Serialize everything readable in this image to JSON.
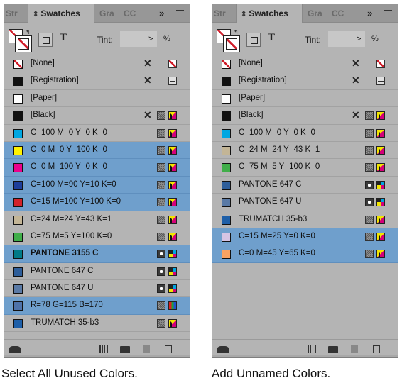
{
  "tabs": {
    "stroke": "Str",
    "swatches": "Swatches",
    "gradient": "Gra",
    "cc": "CC",
    "more": "»"
  },
  "toolbar": {
    "text_icon": "T",
    "tint_label": "Tint:",
    "tint_value": "",
    "tint_arrow": ">",
    "tint_unit": "%"
  },
  "left_panel": {
    "caption": "Select All Unused Colors.",
    "swatches": [
      {
        "name": "[None]",
        "color": "none",
        "selected": false,
        "icons": [
          "scissors-x",
          "none-box"
        ]
      },
      {
        "name": "[Registration]",
        "color": "#111111",
        "selected": false,
        "icons": [
          "scissors-x",
          "registration"
        ]
      },
      {
        "name": "[Paper]",
        "color": "#ffffff",
        "selected": false,
        "icons": []
      },
      {
        "name": "[Black]",
        "color": "#111111",
        "selected": false,
        "icons": [
          "scissors-x",
          "process",
          "cmyk"
        ]
      },
      {
        "name": "C=100 M=0 Y=0 K=0",
        "color": "#00a7e1",
        "selected": false,
        "icons": [
          "process",
          "cmyk"
        ]
      },
      {
        "name": "C=0 M=0 Y=100 K=0",
        "color": "#fff200",
        "selected": true,
        "icons": [
          "process",
          "cmyk"
        ]
      },
      {
        "name": "C=0 M=100 Y=0 K=0",
        "color": "#ec008c",
        "selected": true,
        "icons": [
          "process",
          "cmyk"
        ]
      },
      {
        "name": "C=100 M=90 Y=10 K=0",
        "color": "#1e3f9a",
        "selected": true,
        "icons": [
          "process",
          "cmyk"
        ]
      },
      {
        "name": "C=15 M=100 Y=100 K=0",
        "color": "#d2232a",
        "selected": true,
        "icons": [
          "process",
          "cmyk"
        ]
      },
      {
        "name": "C=24 M=24 Y=43 K=1",
        "color": "#c3b596",
        "selected": false,
        "icons": [
          "process",
          "cmyk"
        ]
      },
      {
        "name": "C=75 M=5 Y=100 K=0",
        "color": "#40ae49",
        "selected": false,
        "icons": [
          "process",
          "cmyk"
        ]
      },
      {
        "name": "PANTONE 3155 C",
        "color": "#007a87",
        "selected": true,
        "bold": true,
        "icons": [
          "spot",
          "cmyk4"
        ]
      },
      {
        "name": "PANTONE 647 C",
        "color": "#2e5e9a",
        "selected": false,
        "icons": [
          "spot",
          "cmyk4"
        ]
      },
      {
        "name": "PANTONE 647 U",
        "color": "#5a7aa6",
        "selected": false,
        "icons": [
          "spot",
          "cmyk4"
        ]
      },
      {
        "name": "R=78 G=115 B=170",
        "color": "#4e73aa",
        "selected": true,
        "icons": [
          "process",
          "rgb"
        ]
      },
      {
        "name": "TRUMATCH 35-b3",
        "color": "#1e5fa8",
        "selected": false,
        "icons": [
          "process",
          "cmyk"
        ]
      }
    ]
  },
  "right_panel": {
    "caption": "Add Unnamed Colors.",
    "swatches": [
      {
        "name": "[None]",
        "color": "none",
        "selected": false,
        "icons": [
          "scissors-x",
          "none-box"
        ]
      },
      {
        "name": "[Registration]",
        "color": "#111111",
        "selected": false,
        "icons": [
          "scissors-x",
          "registration"
        ]
      },
      {
        "name": "[Paper]",
        "color": "#ffffff",
        "selected": false,
        "icons": []
      },
      {
        "name": "[Black]",
        "color": "#111111",
        "selected": false,
        "icons": [
          "scissors-x",
          "process",
          "cmyk"
        ]
      },
      {
        "name": "C=100 M=0 Y=0 K=0",
        "color": "#00a7e1",
        "selected": false,
        "icons": [
          "process",
          "cmyk"
        ]
      },
      {
        "name": "C=24 M=24 Y=43 K=1",
        "color": "#c3b596",
        "selected": false,
        "icons": [
          "process",
          "cmyk"
        ]
      },
      {
        "name": "C=75 M=5 Y=100 K=0",
        "color": "#40ae49",
        "selected": false,
        "icons": [
          "process",
          "cmyk"
        ]
      },
      {
        "name": "PANTONE 647 C",
        "color": "#2e5e9a",
        "selected": false,
        "icons": [
          "spot",
          "cmyk4"
        ]
      },
      {
        "name": "PANTONE 647 U",
        "color": "#5a7aa6",
        "selected": false,
        "icons": [
          "spot",
          "cmyk4"
        ]
      },
      {
        "name": "TRUMATCH 35-b3",
        "color": "#1e5fa8",
        "selected": false,
        "icons": [
          "process",
          "cmyk"
        ]
      },
      {
        "name": "C=15 M=25 Y=0 K=0",
        "color": "#d6c4e4",
        "selected": true,
        "icons": [
          "process",
          "cmyk"
        ]
      },
      {
        "name": "C=0 M=45 Y=65 K=0",
        "color": "#f8a262",
        "selected": true,
        "icons": [
          "process",
          "cmyk"
        ]
      }
    ]
  }
}
